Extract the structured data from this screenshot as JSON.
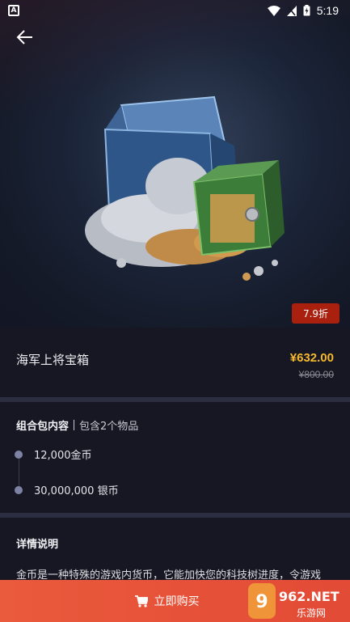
{
  "status_bar": {
    "time": "5:19",
    "notification_letter": "A"
  },
  "discount_badge": "7.9折",
  "product": {
    "name": "海军上将宝箱",
    "price": "¥632.00",
    "original_price": "¥800.00"
  },
  "bundle": {
    "title": "组合包内容",
    "count_text": "包含2个物品",
    "items": [
      {
        "label": "12,000金币"
      },
      {
        "label": "30,000,000 银币"
      }
    ]
  },
  "details": {
    "title": "详情说明",
    "text": "金币是一种特殊的游戏内货币，它能加快您的科技树进度，令游戏"
  },
  "buy_button": {
    "label": "立即购买"
  },
  "watermark": {
    "brand": "962.NET",
    "sub": "乐游网"
  },
  "colors": {
    "accent_price": "#f5b82e",
    "badge_red": "#a9200f",
    "buy_orange": "#ea5a3c",
    "background": "#161722"
  }
}
